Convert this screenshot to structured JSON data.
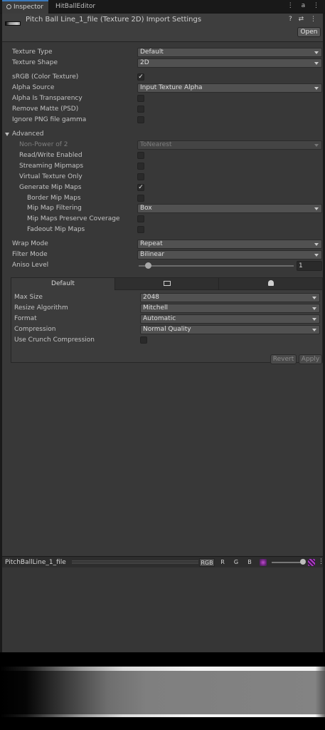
{
  "window_tabs": {
    "inspector": "Inspector",
    "editor": "HitBallEditor",
    "tools": "⋮ a ⋮"
  },
  "header": {
    "title": "Pitch Ball Line_1_file (Texture 2D) Import Settings",
    "icons": "? ⇄ ⋮",
    "open_label": "Open"
  },
  "fields": {
    "texture_type": {
      "label": "Texture Type",
      "value": "Default"
    },
    "texture_shape": {
      "label": "Texture Shape",
      "value": "2D"
    },
    "srgb": {
      "label": "sRGB (Color Texture)",
      "checked": true
    },
    "alpha_source": {
      "label": "Alpha Source",
      "value": "Input Texture Alpha"
    },
    "alpha_transparency": {
      "label": "Alpha Is Transparency",
      "checked": false
    },
    "remove_matte": {
      "label": "Remove Matte (PSD)",
      "checked": false
    },
    "ignore_png_gamma": {
      "label": "Ignore PNG file gamma",
      "checked": false
    }
  },
  "advanced": {
    "label": "Advanced",
    "npot": {
      "label": "Non-Power of 2",
      "value": "ToNearest"
    },
    "read_write": {
      "label": "Read/Write Enabled",
      "checked": false
    },
    "streaming_mipmaps": {
      "label": "Streaming Mipmaps",
      "checked": false
    },
    "virtual_texture": {
      "label": "Virtual Texture Only",
      "checked": false
    },
    "generate_mips": {
      "label": "Generate Mip Maps",
      "checked": true
    },
    "border_mips": {
      "label": "Border Mip Maps",
      "checked": false
    },
    "mip_filtering": {
      "label": "Mip Map Filtering",
      "value": "Box"
    },
    "preserve_coverage": {
      "label": "Mip Maps Preserve Coverage",
      "checked": false
    },
    "fadeout_mips": {
      "label": "Fadeout Mip Maps",
      "checked": false
    }
  },
  "sampling": {
    "wrap_mode": {
      "label": "Wrap Mode",
      "value": "Repeat"
    },
    "filter_mode": {
      "label": "Filter Mode",
      "value": "Bilinear"
    },
    "aniso_level": {
      "label": "Aniso Level",
      "value": 1
    }
  },
  "platform": {
    "tabs": [
      "Default",
      "monitor-icon",
      "android-icon"
    ],
    "max_size": {
      "label": "Max Size",
      "value": "2048"
    },
    "resize_algorithm": {
      "label": "Resize Algorithm",
      "value": "Mitchell"
    },
    "format": {
      "label": "Format",
      "value": "Automatic"
    },
    "compression": {
      "label": "Compression",
      "value": "Normal Quality"
    },
    "crunch": {
      "label": "Use Crunch Compression",
      "checked": false
    }
  },
  "buttons": {
    "revert": "Revert",
    "apply": "Apply"
  },
  "preview": {
    "name": "PitchBallLine_1_file",
    "channels": [
      "RGB",
      "R",
      "G",
      "B"
    ],
    "active_channel": "RGB"
  },
  "check_glyph": "✓",
  "colors": {
    "accent": "#3a79bb",
    "panel": "#383838",
    "field": "#515151"
  }
}
